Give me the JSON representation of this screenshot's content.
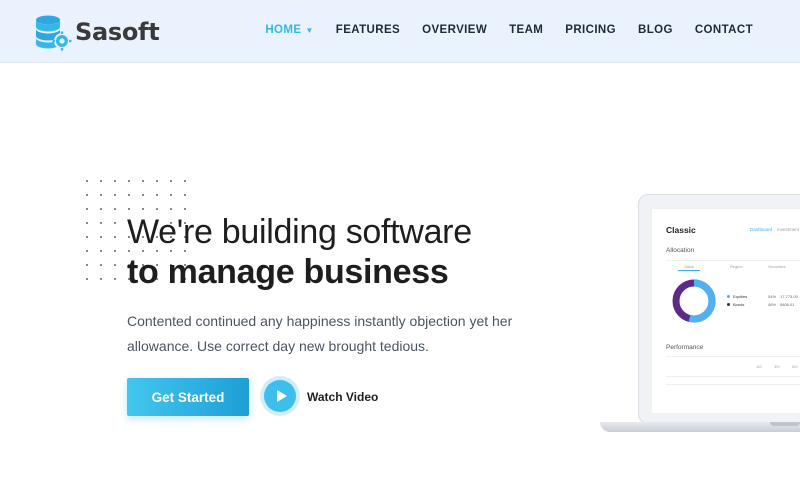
{
  "brand": {
    "name": "Sasoft"
  },
  "nav": {
    "items": [
      {
        "label": "HOME",
        "active": true
      },
      {
        "label": "FEATURES"
      },
      {
        "label": "OVERVIEW"
      },
      {
        "label": "TEAM"
      },
      {
        "label": "PRICING"
      },
      {
        "label": "BLOG"
      },
      {
        "label": "CONTACT"
      }
    ]
  },
  "hero": {
    "title_line1": "We're building software",
    "title_line2": "to manage business",
    "description": "Contented continued any happiness instantly objection yet her allowance. Use correct day new brought tedious.",
    "primary_button": "Get Started",
    "video_label": "Watch Video"
  },
  "dashboard_preview": {
    "title": "Classic",
    "tabs": [
      "Dashboard",
      "Investment"
    ],
    "allocation_label": "Allocation",
    "sub_tabs": [
      "Value",
      "Region",
      "Securities"
    ],
    "legend": [
      {
        "label": "Equities",
        "color": "#4fb0f3",
        "pct": "54%",
        "value": "17,773.00"
      },
      {
        "label": "Bonds",
        "color": "#5b2a8a",
        "pct": "46%",
        "value": "5806.01"
      }
    ],
    "performance_label": "Performance",
    "performance_ticks": [
      "1M",
      "3M",
      "6M"
    ]
  },
  "colors": {
    "accent": "#33b7e8",
    "button_start": "#43c6ee",
    "button_end": "#1e9fd6",
    "header_bg": "#eaf3fd"
  }
}
